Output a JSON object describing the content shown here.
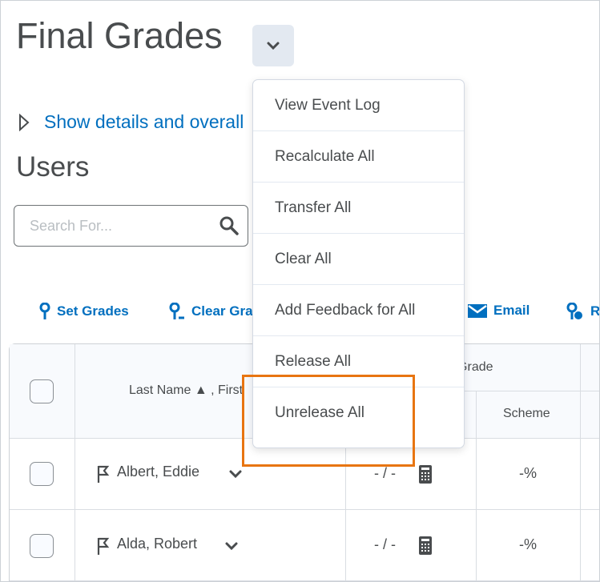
{
  "page": {
    "title": "Final Grades",
    "show_details": "Show details and overall",
    "section": "Users"
  },
  "search": {
    "placeholder": "Search For..."
  },
  "toolbar": [
    {
      "label": "Set Grades",
      "icon": "set-grades-icon"
    },
    {
      "label": "Clear Grades",
      "icon": "clear-grades-icon"
    },
    {
      "label": "Email",
      "icon": "email-icon"
    },
    {
      "label": "R",
      "icon": "release-icon"
    }
  ],
  "table": {
    "headers": {
      "name": "Last Name ▲ , First",
      "calculated": "Calculated Grade",
      "scheme": "Scheme"
    },
    "rows": [
      {
        "name": "Albert, Eddie",
        "grade": "- / -",
        "scheme": "-%"
      },
      {
        "name": "Alda, Robert",
        "grade": "- / -",
        "scheme": "-%"
      }
    ]
  },
  "menu": {
    "items": [
      "View Event Log",
      "Recalculate All",
      "Transfer All",
      "Clear All",
      "Add Feedback for All",
      "Release All",
      "Unrelease All"
    ]
  },
  "colors": {
    "link": "#006fbf",
    "highlight": "#e87511"
  }
}
